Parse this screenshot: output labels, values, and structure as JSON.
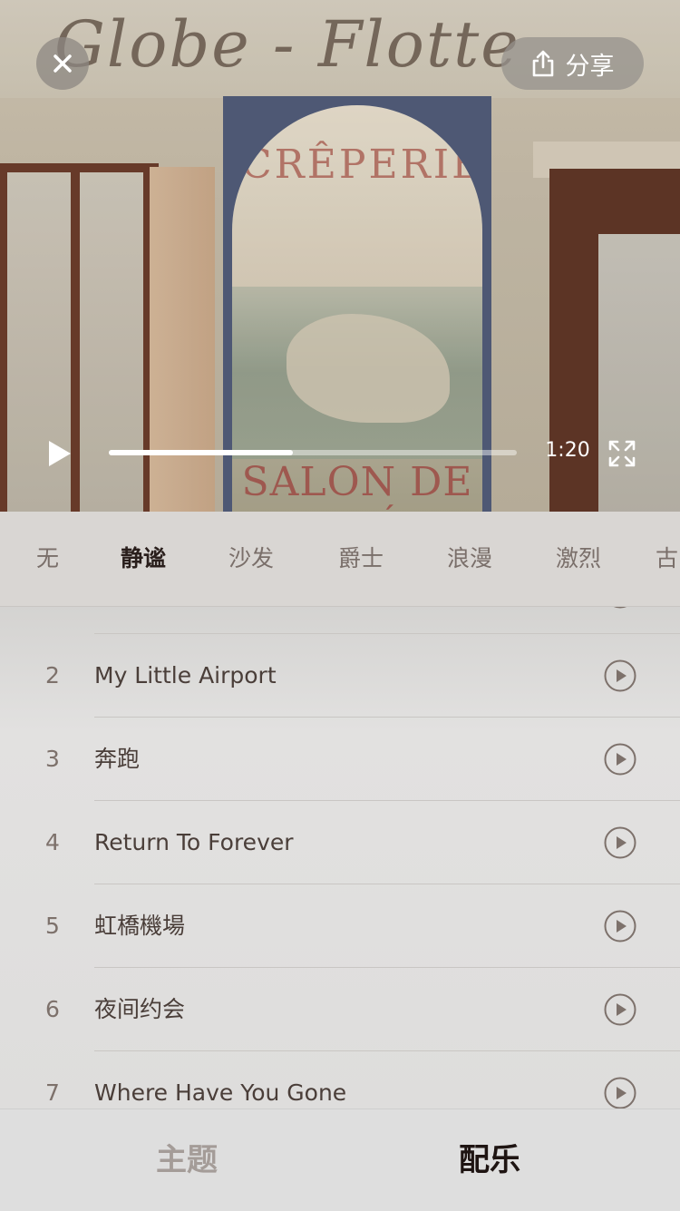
{
  "video": {
    "sign_text": "Globe - Flotte",
    "panel_top_text": "CRÊPERIE",
    "panel_bottom_text": "SALON DE THÉ",
    "duration": "1:20",
    "progress": 0.45
  },
  "header": {
    "share_label": "分享"
  },
  "categories": [
    {
      "label": "无"
    },
    {
      "label": "静谧",
      "active": true
    },
    {
      "label": "沙发"
    },
    {
      "label": "爵士"
    },
    {
      "label": "浪漫"
    },
    {
      "label": "激烈"
    },
    {
      "label": "古"
    }
  ],
  "tracks": [
    {
      "number": "2",
      "title": "My Little Airport"
    },
    {
      "number": "3",
      "title": "奔跑"
    },
    {
      "number": "4",
      "title": "Return To Forever"
    },
    {
      "number": "5",
      "title": "虹橋機場"
    },
    {
      "number": "6",
      "title": "夜间约会"
    },
    {
      "number": "7",
      "title": "Where Have You Gone"
    }
  ],
  "bottom_tabs": {
    "theme_label": "主题",
    "music_label": "配乐",
    "active": "music"
  },
  "icons": {
    "close": "close-icon",
    "share": "share-icon",
    "play": "play-icon",
    "fullscreen": "fullscreen-icon",
    "track_play": "play-circle-icon"
  }
}
